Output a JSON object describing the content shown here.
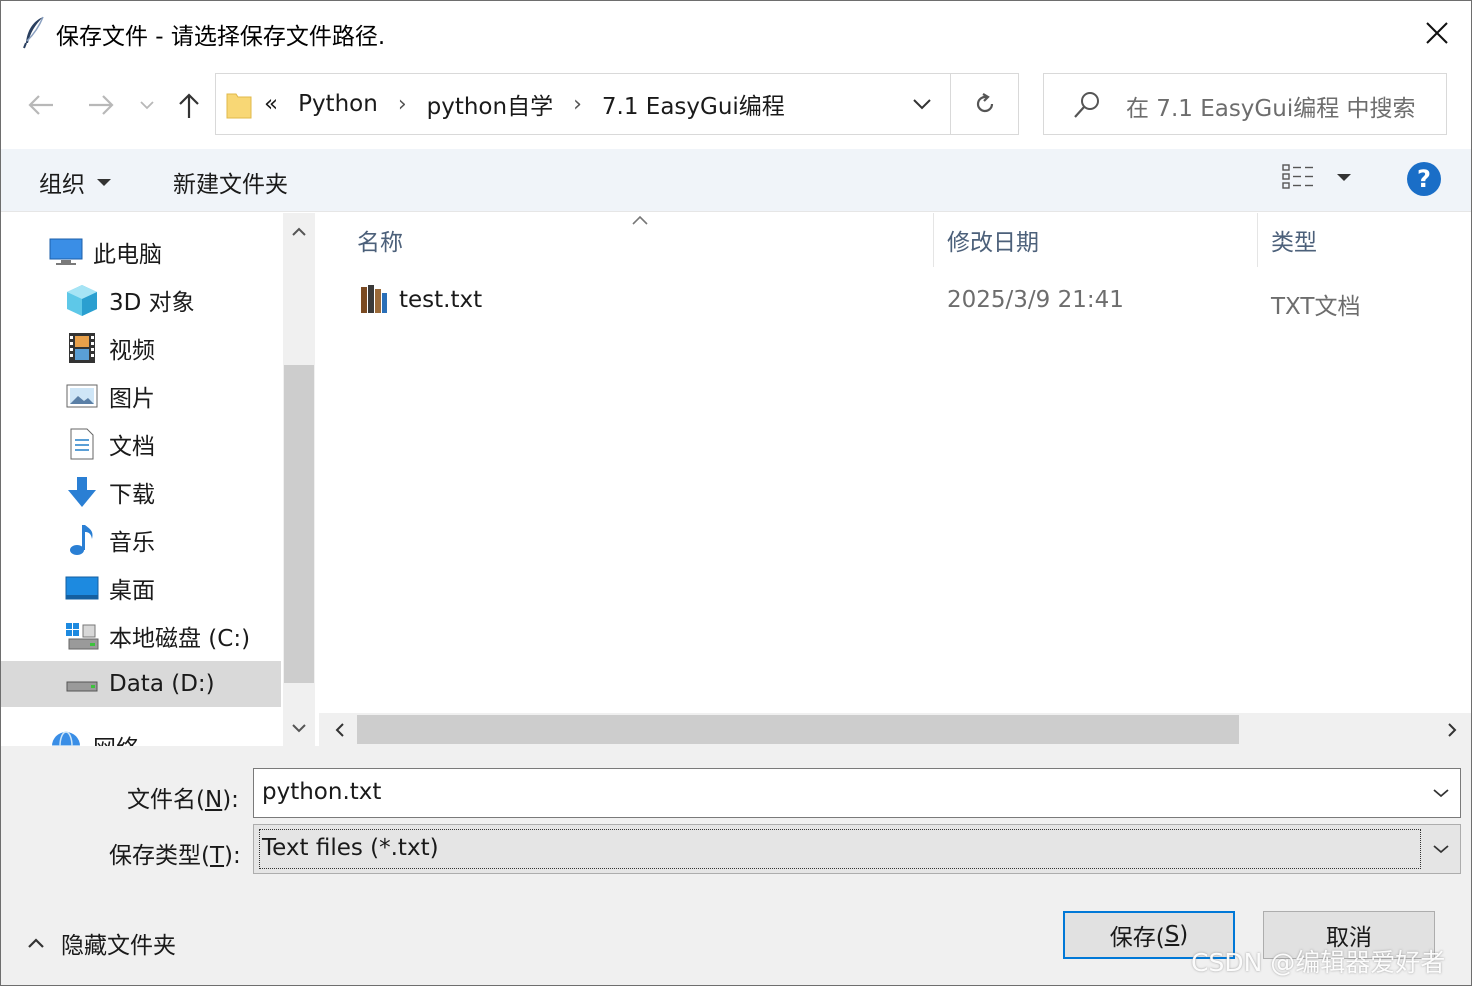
{
  "window": {
    "title": "保存文件 - 请选择保存文件路径."
  },
  "address": {
    "overflow": "«",
    "segments": [
      "Python",
      "python自学",
      "7.1 EasyGui编程"
    ],
    "separator": "›"
  },
  "search": {
    "placeholder": "在 7.1 EasyGui编程 中搜索"
  },
  "toolbar": {
    "organize": "组织",
    "new_folder": "新建文件夹",
    "help": "?"
  },
  "nav": {
    "items": [
      {
        "label": "此电脑",
        "icon": "computer-icon"
      },
      {
        "label": "3D 对象",
        "icon": "3d-objects-icon"
      },
      {
        "label": "视频",
        "icon": "video-icon"
      },
      {
        "label": "图片",
        "icon": "pictures-icon"
      },
      {
        "label": "文档",
        "icon": "documents-icon"
      },
      {
        "label": "下载",
        "icon": "download-icon"
      },
      {
        "label": "音乐",
        "icon": "music-icon"
      },
      {
        "label": "桌面",
        "icon": "desktop-icon"
      },
      {
        "label": "本地磁盘 (C:)",
        "icon": "local-disk-icon"
      },
      {
        "label": "Data (D:)",
        "icon": "drive-icon",
        "selected": true
      },
      {
        "label": "网络",
        "icon": "network-icon"
      }
    ]
  },
  "columns": {
    "name": "名称",
    "modified": "修改日期",
    "type": "类型"
  },
  "files": [
    {
      "name": "test.txt",
      "modified": "2025/3/9 21:41",
      "type": "TXT文档"
    }
  ],
  "form": {
    "filename_label_pre": "文件名(",
    "filename_label_key": "N",
    "filename_label_post": "):",
    "filename_value": "python.txt",
    "type_label_pre": "保存类型(",
    "type_label_key": "T",
    "type_label_post": "):",
    "type_value": "Text files (*.txt)"
  },
  "footer": {
    "hide_folders": "隐藏文件夹",
    "save_pre": "保存(",
    "save_key": "S",
    "save_post": ")",
    "cancel": "取消",
    "watermark": "CSDN @编辑器爱好者"
  },
  "colors": {
    "accent": "#0078d7",
    "help": "#1a6ec7",
    "selection": "#d9d9d9"
  }
}
